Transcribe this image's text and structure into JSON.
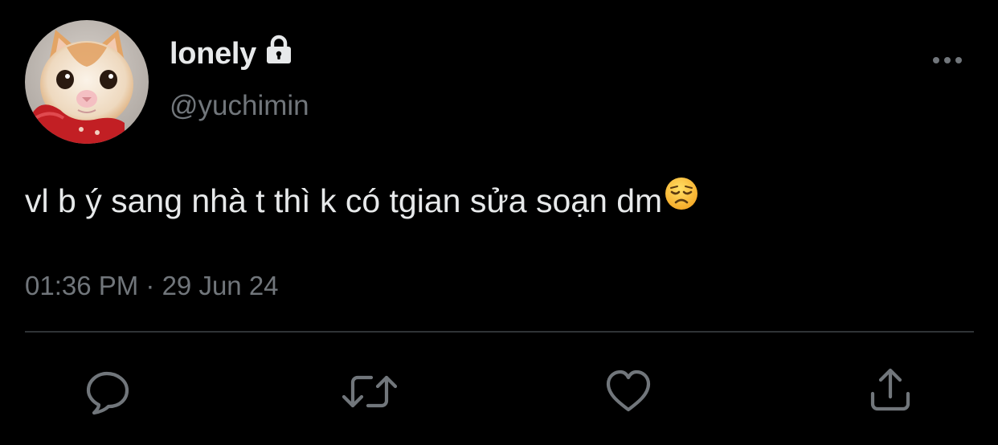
{
  "tweet": {
    "display_name": "lonely",
    "handle": "@yuchimin",
    "protected": true,
    "text": "vl b ý sang nhà t thì k có tgian sửa soạn dm",
    "emoji": "disappointed-face",
    "time": "01:36 PM",
    "separator": " · ",
    "date": "29 Jun 24"
  },
  "actions": [
    {
      "name": "reply",
      "icon": "speech-bubble-outline"
    },
    {
      "name": "retweet",
      "icon": "repeat-arrows"
    },
    {
      "name": "like",
      "icon": "heart-outline"
    },
    {
      "name": "share",
      "icon": "share-upload"
    }
  ],
  "colors": {
    "background": "#000000",
    "primary_text": "#e7e9ea",
    "secondary_text": "#71767b",
    "divider": "#2f3336"
  }
}
